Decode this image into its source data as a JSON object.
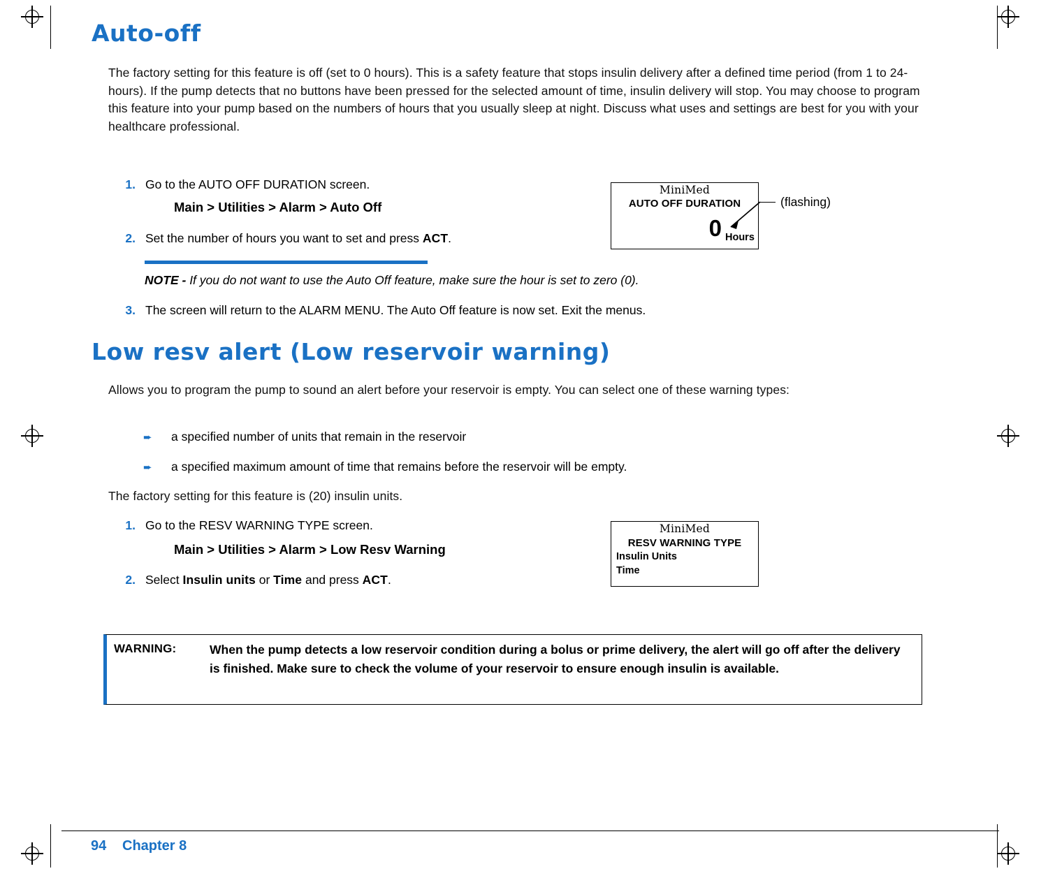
{
  "sections": [
    {
      "heading": "Auto-off",
      "paragraph": "The factory setting for this feature is off (set to 0 hours). This is a safety feature that stops insulin delivery after a defined time period (from 1 to 24-hours). If the pump detects that no buttons have been pressed for the selected amount of time, insulin delivery will stop. You may choose to program this feature into your pump based on the numbers of hours that you usually sleep at night. Discuss what uses and settings are best for you with your healthcare professional.",
      "steps": [
        {
          "num": "1.",
          "text": "Go to the AUTO OFF DURATION screen."
        },
        {
          "num": "2.",
          "text": "Set the number of hours you want to set and press ACT."
        },
        {
          "num": "3.",
          "text": "The screen will return to the ALARM MENU. The Auto Off feature is now set. Exit the menus."
        }
      ],
      "menu_path": "Main > Utilities > Alarm > Auto Off",
      "note_label": "NOTE -",
      "note_text": "If you do not want to use the Auto Off feature, make sure the hour is set to zero (0)."
    },
    {
      "heading": "Low resv alert (Low reservoir warning)",
      "paragraph": "Allows you to program the pump to sound an alert before your reservoir is empty. You can select one of these warning types:",
      "bullets": [
        "a specified number of units that remain in the reservoir",
        "a specified maximum amount of time that remains before the reservoir will be empty."
      ],
      "paragraph2": "The factory setting for this feature is (20) insulin units.",
      "steps": [
        {
          "num": "1.",
          "text": "Go to the RESV WARNING TYPE screen."
        },
        {
          "num": "2.",
          "text": "Select Insulin units or Time and press ACT."
        }
      ],
      "menu_path": "Main > Utilities > Alarm > Low Resv Warning"
    }
  ],
  "pump_screen_1": {
    "brand": "MiniMed",
    "title": "AUTO OFF DURATION",
    "value": "0",
    "units": "Hours",
    "callout": "(flashing)"
  },
  "pump_screen_2": {
    "brand": "MiniMed",
    "title": "RESV WARNING TYPE",
    "options": [
      "Insulin Units",
      "Time"
    ]
  },
  "warning": {
    "label": "WARNING:",
    "text": "When the pump detects a low reservoir condition during a bolus or prime delivery, the alert will go off after the delivery is finished. Make sure to check the volume of your reservoir to ensure enough insulin is available."
  },
  "footer": {
    "page_number": "94",
    "chapter": "Chapter 8"
  },
  "colors": {
    "accent": "#1a71c4"
  }
}
